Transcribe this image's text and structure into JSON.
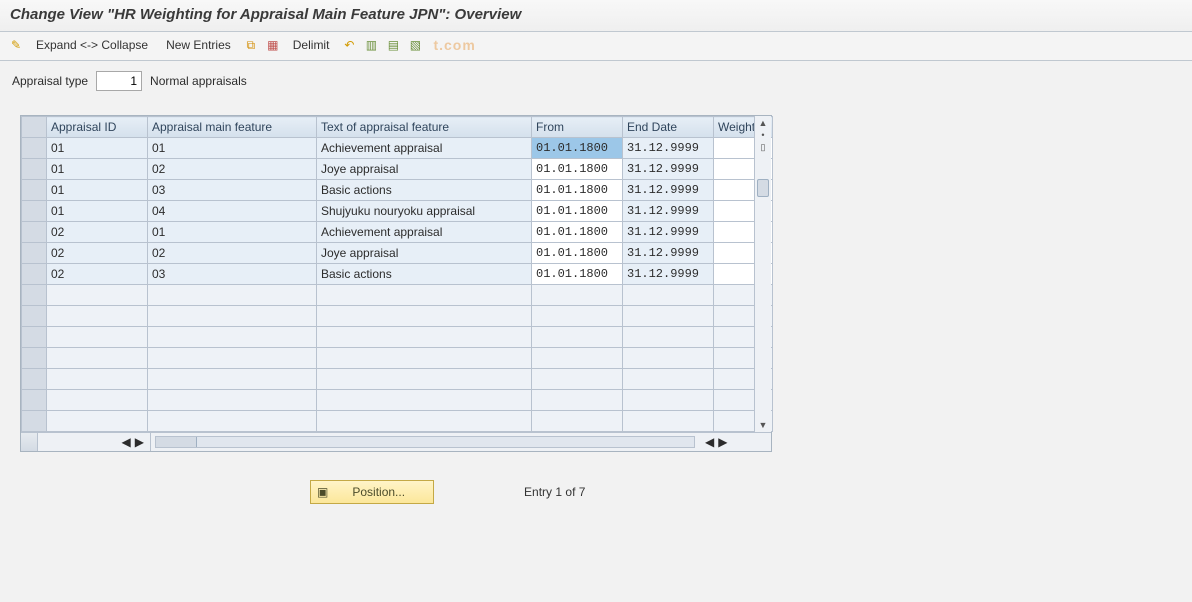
{
  "title": "Change View \"HR Weighting for Appraisal Main Feature JPN\": Overview",
  "toolbar": {
    "expand_collapse": "Expand <-> Collapse",
    "new_entries": "New Entries",
    "delimit": "Delimit",
    "watermark": "t.com"
  },
  "filter": {
    "label": "Appraisal type",
    "value": "1",
    "text": "Normal appraisals"
  },
  "table": {
    "headers": {
      "id": "Appraisal ID",
      "main": "Appraisal main feature",
      "text": "Text of appraisal feature",
      "from": "From",
      "end": "End Date",
      "wt": "Weighting"
    },
    "rows": [
      {
        "id": "01",
        "main": "01",
        "text": "Achievement appraisal",
        "from": "01.01.1800",
        "end": "31.12.9999",
        "wt": "",
        "sel_from": true
      },
      {
        "id": "01",
        "main": "02",
        "text": "Joye appraisal",
        "from": "01.01.1800",
        "end": "31.12.9999",
        "wt": ""
      },
      {
        "id": "01",
        "main": "03",
        "text": "Basic actions",
        "from": "01.01.1800",
        "end": "31.12.9999",
        "wt": ""
      },
      {
        "id": "01",
        "main": "04",
        "text": "Shujyuku nouryoku appraisal",
        "from": "01.01.1800",
        "end": "31.12.9999",
        "wt": ""
      },
      {
        "id": "02",
        "main": "01",
        "text": "Achievement appraisal",
        "from": "01.01.1800",
        "end": "31.12.9999",
        "wt": ""
      },
      {
        "id": "02",
        "main": "02",
        "text": "Joye appraisal",
        "from": "01.01.1800",
        "end": "31.12.9999",
        "wt": ""
      },
      {
        "id": "02",
        "main": "03",
        "text": "Basic actions",
        "from": "01.01.1800",
        "end": "31.12.9999",
        "wt": ""
      }
    ],
    "empty_rows": 7
  },
  "footer": {
    "position_btn": "Position...",
    "entry_status": "Entry 1 of 7"
  }
}
